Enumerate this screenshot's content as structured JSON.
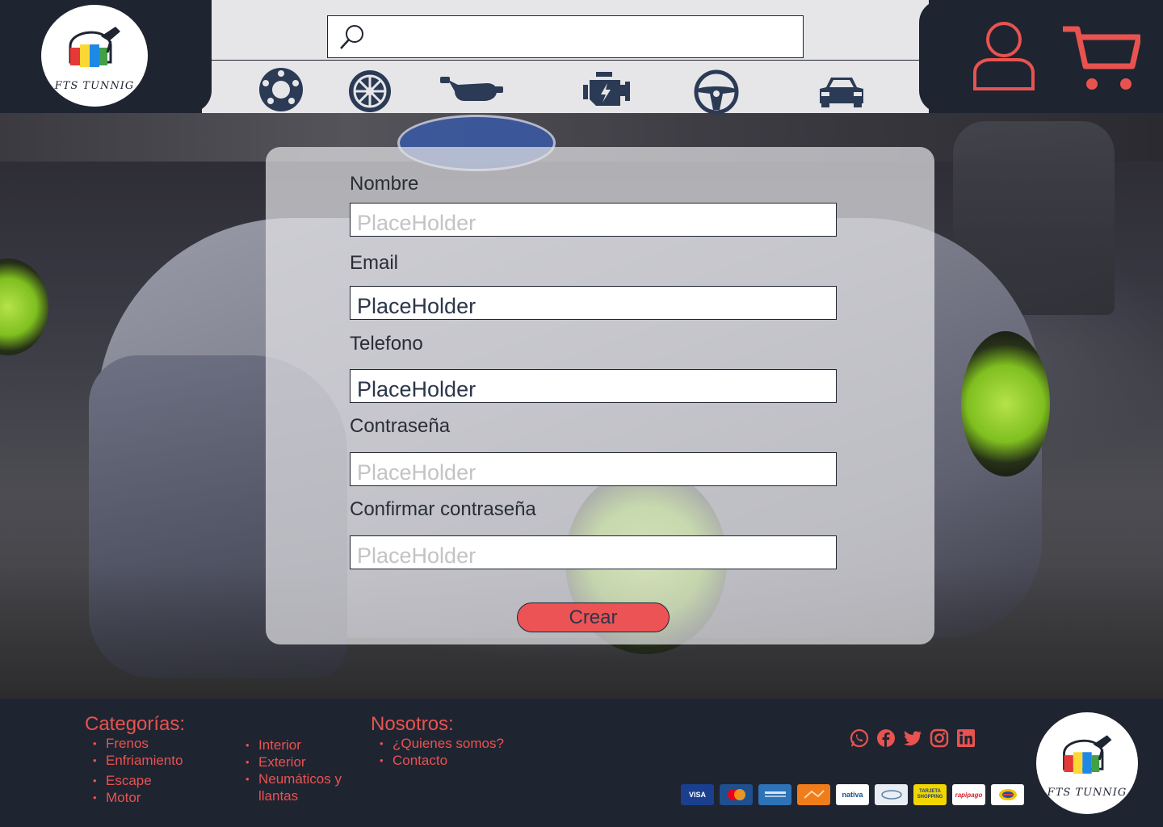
{
  "brand": {
    "name": "FTS TUNNIG"
  },
  "header": {
    "search": {
      "value": "",
      "placeholder": ""
    },
    "categories": [
      {
        "icon": "brake-disc-icon"
      },
      {
        "icon": "wheel-icon"
      },
      {
        "icon": "exhaust-icon"
      },
      {
        "icon": "engine-icon"
      },
      {
        "icon": "steering-wheel-icon"
      },
      {
        "icon": "car-icon"
      }
    ],
    "actions": [
      {
        "icon": "user-icon"
      },
      {
        "icon": "cart-icon"
      }
    ]
  },
  "form": {
    "fields": [
      {
        "label": "Nombre",
        "placeholder": "PlaceHolder",
        "style": "muted"
      },
      {
        "label": "Email",
        "placeholder": "PlaceHolder",
        "style": "dark"
      },
      {
        "label": "Telefono",
        "placeholder": "PlaceHolder",
        "style": "dark"
      },
      {
        "label": "Contraseña",
        "placeholder": "PlaceHolder",
        "style": "muted"
      },
      {
        "label": "Confirmar contraseña",
        "placeholder": "PlaceHolder",
        "style": "muted"
      }
    ],
    "submit_label": "Crear"
  },
  "footer": {
    "categories_title": "Categorías:",
    "categories_col1": [
      "Frenos",
      "Enfriamiento",
      "Escape",
      "Motor"
    ],
    "categories_col2": [
      "Interior",
      "Exterior",
      "Neumáticos y llantas"
    ],
    "nosotros_title": "Nosotros:",
    "nosotros": [
      "¿Quienes somos?",
      "Contacto"
    ],
    "socials": [
      "whatsapp-icon",
      "facebook-icon",
      "twitter-icon",
      "instagram-icon",
      "linkedin-icon"
    ],
    "payments": [
      "VISA",
      "",
      "",
      "",
      "nativa",
      "",
      "TARJETA SHOPPING",
      "rapipago",
      ""
    ]
  },
  "colors": {
    "navy": "#1f2431",
    "accent": "#e9534f",
    "icon_blue": "#2b3a55",
    "header_bg": "#e6e6e8"
  }
}
